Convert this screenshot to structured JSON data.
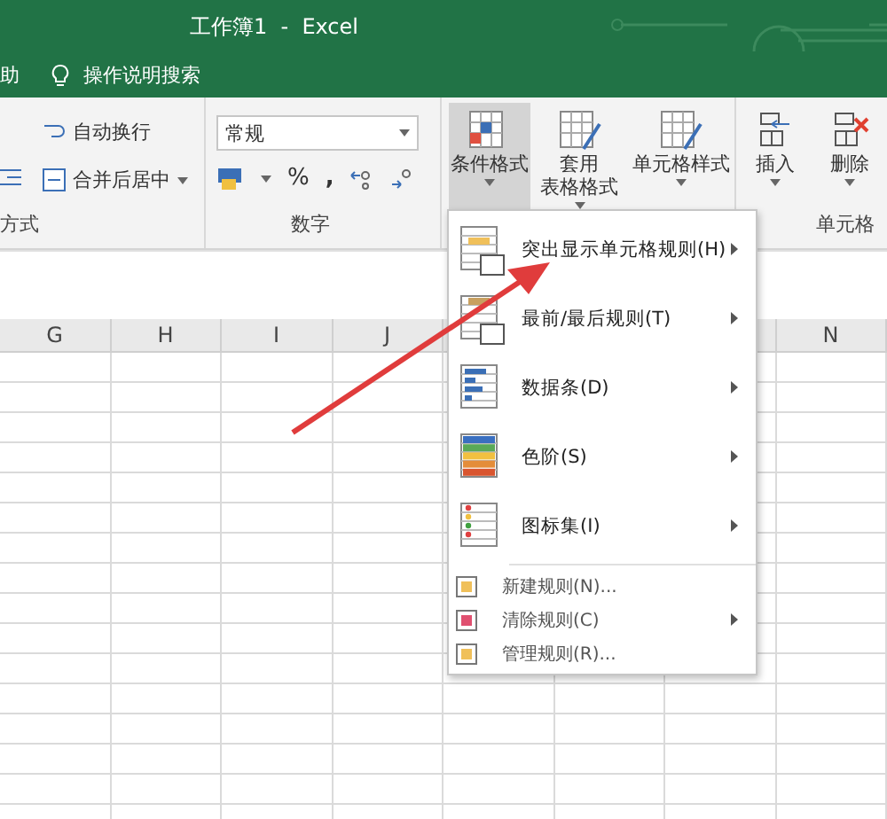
{
  "window": {
    "title": "工作簿1  -  Excel"
  },
  "menu_bar": {
    "items": [
      {
        "label": "助"
      }
    ],
    "search": {
      "placeholder": "操作说明搜索"
    }
  },
  "ribbon": {
    "alignment": {
      "label": "方式",
      "wrap": "自动换行",
      "merge": "合并后居中"
    },
    "number": {
      "label": "数字",
      "format": "常规",
      "percent": "%",
      "comma": ","
    },
    "styles": [
      {
        "lines": [
          "条件格式"
        ],
        "selected": true
      },
      {
        "lines": [
          "套用",
          "表格格式"
        ],
        "selected": false
      },
      {
        "lines": [
          "单元格样式"
        ],
        "selected": false
      }
    ],
    "cells": {
      "label": "单元格",
      "buttons": [
        "插入",
        "删除"
      ]
    }
  },
  "sheet": {
    "columns": [
      "G",
      "H",
      "I",
      "J",
      "N"
    ]
  },
  "menu": [
    {
      "kind": "large",
      "label": "突出显示单元格规则(H)",
      "submenu": true
    },
    {
      "kind": "large",
      "label": "最前/最后规则(T)",
      "submenu": true
    },
    {
      "kind": "large",
      "label": "数据条(D)",
      "submenu": true
    },
    {
      "kind": "large",
      "label": "色阶(S)",
      "submenu": true
    },
    {
      "kind": "large",
      "label": "图标集(I)",
      "submenu": true
    },
    {
      "kind": "small",
      "label": "新建规则(N)...",
      "submenu": false
    },
    {
      "kind": "small",
      "label": "清除规则(C)",
      "submenu": true
    },
    {
      "kind": "small",
      "label": "管理规则(R)...",
      "submenu": false
    }
  ]
}
